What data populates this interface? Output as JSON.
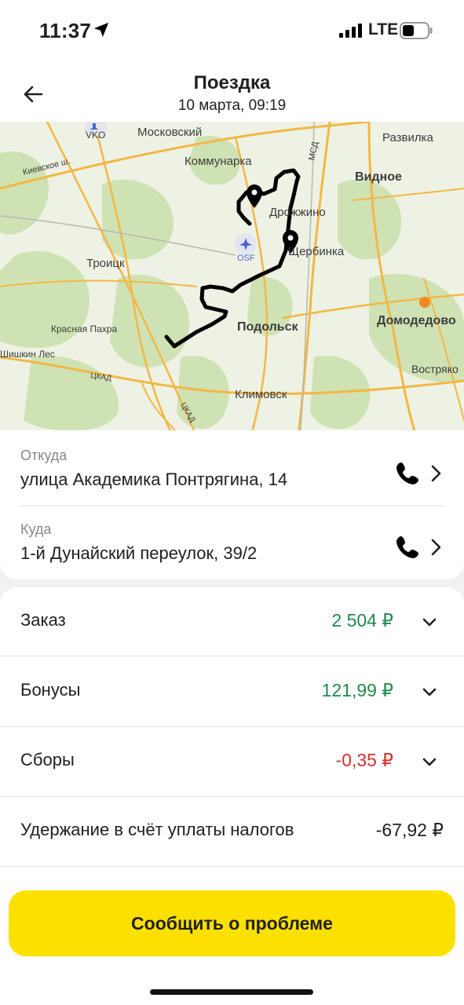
{
  "status_bar": {
    "time": "11:37",
    "network": "LTE",
    "icons": [
      "location-arrow-icon",
      "signal-icon",
      "battery-icon"
    ]
  },
  "header": {
    "title": "Поездка",
    "subtitle": "10 марта, 09:19",
    "back_icon": "arrow-left-icon"
  },
  "map": {
    "labels": {
      "vko": "VKO",
      "moskovsky": "Московский",
      "razvilka": "Развилка",
      "msd": "МСД",
      "kievskoe": "Киевское ш.",
      "kommunarka": "Коммунарка",
      "vidnoe": "Видное",
      "drozhzhino": "Дрожжино",
      "shcherbinka": "Щербинка",
      "osf": "OSF",
      "troitsk": "Троицк",
      "domodedovo": "Домодедово",
      "krasnaya_pakhra": "Красная Пахра",
      "podolsk": "Подольск",
      "shishkin_les": "Шишкин Лес",
      "tskad1": "ЦКАД",
      "tskad2": "ЦКАД",
      "vostryakovo": "Востряко",
      "klimovsk": "Климовск"
    },
    "colors": {
      "route": "#000000",
      "roads": "#f3b743",
      "forest": "#cfe2b4",
      "background": "#eef2e4"
    }
  },
  "addresses": {
    "from": {
      "label": "Откуда",
      "value": "улица Академика Понтрягина, 14"
    },
    "to": {
      "label": "Куда",
      "value": "1-й Дунайский переулок, 39/2"
    }
  },
  "finance": {
    "rows": [
      {
        "label": "Заказ",
        "amount": "2 504 ₽",
        "color": "#1f8a4c"
      },
      {
        "label": "Бонусы",
        "amount": "121,99 ₽",
        "color": "#1f8a4c"
      },
      {
        "label": "Сборы",
        "amount": "-0,35 ₽",
        "color": "#d1322c"
      },
      {
        "label": "Удержание в счёт уплаты налогов",
        "amount": "-67,92 ₽",
        "color": "#21201f"
      }
    ]
  },
  "actions": {
    "report_button": "Сообщить о проблеме",
    "accent": "#fce000"
  }
}
